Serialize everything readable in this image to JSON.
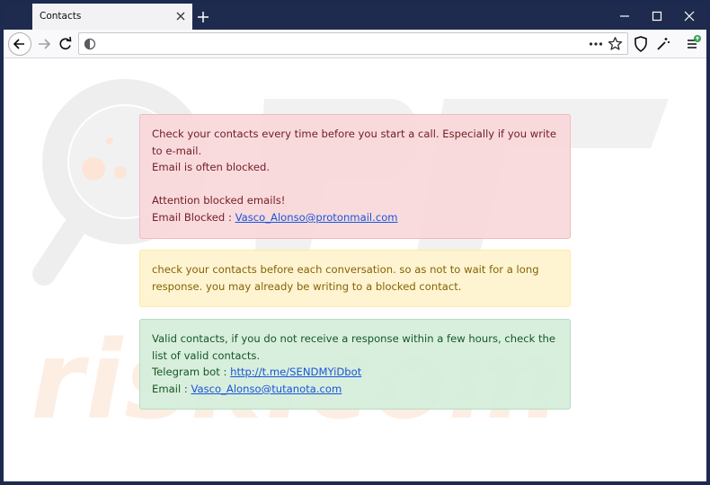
{
  "browser": {
    "tab_title": "Contacts",
    "url_value": "",
    "page_actions_icon": "ellipsis-icon"
  },
  "alerts": {
    "danger": {
      "line1": "Check your contacts every time before you start a call. Especially if you write to e-mail.",
      "line2": "Email is often blocked.",
      "line3": "Attention blocked emails!",
      "blocked_label": "Email Blocked : ",
      "blocked_email": "Vasco_Alonso@protonmail.com"
    },
    "warning": {
      "text": "check your contacts before each conversation. so as not to wait for a long response. you may already be writing to a blocked contact."
    },
    "success": {
      "line1": "Valid contacts, if you do not receive a response within a few hours, check the list of valid contacts.",
      "telegram_label": "Telegram bot : ",
      "telegram_link": "http://t.me/SENDMYiDbot",
      "email_label": "Email : ",
      "email_link": "Vasco_Alonso@tutanota.com"
    }
  },
  "colors": {
    "titlebar": "#1f2b4e",
    "danger_bg": "#f8d7da",
    "warning_bg": "#fff3cd",
    "success_bg": "#d4edda",
    "link": "#1a55d8"
  }
}
